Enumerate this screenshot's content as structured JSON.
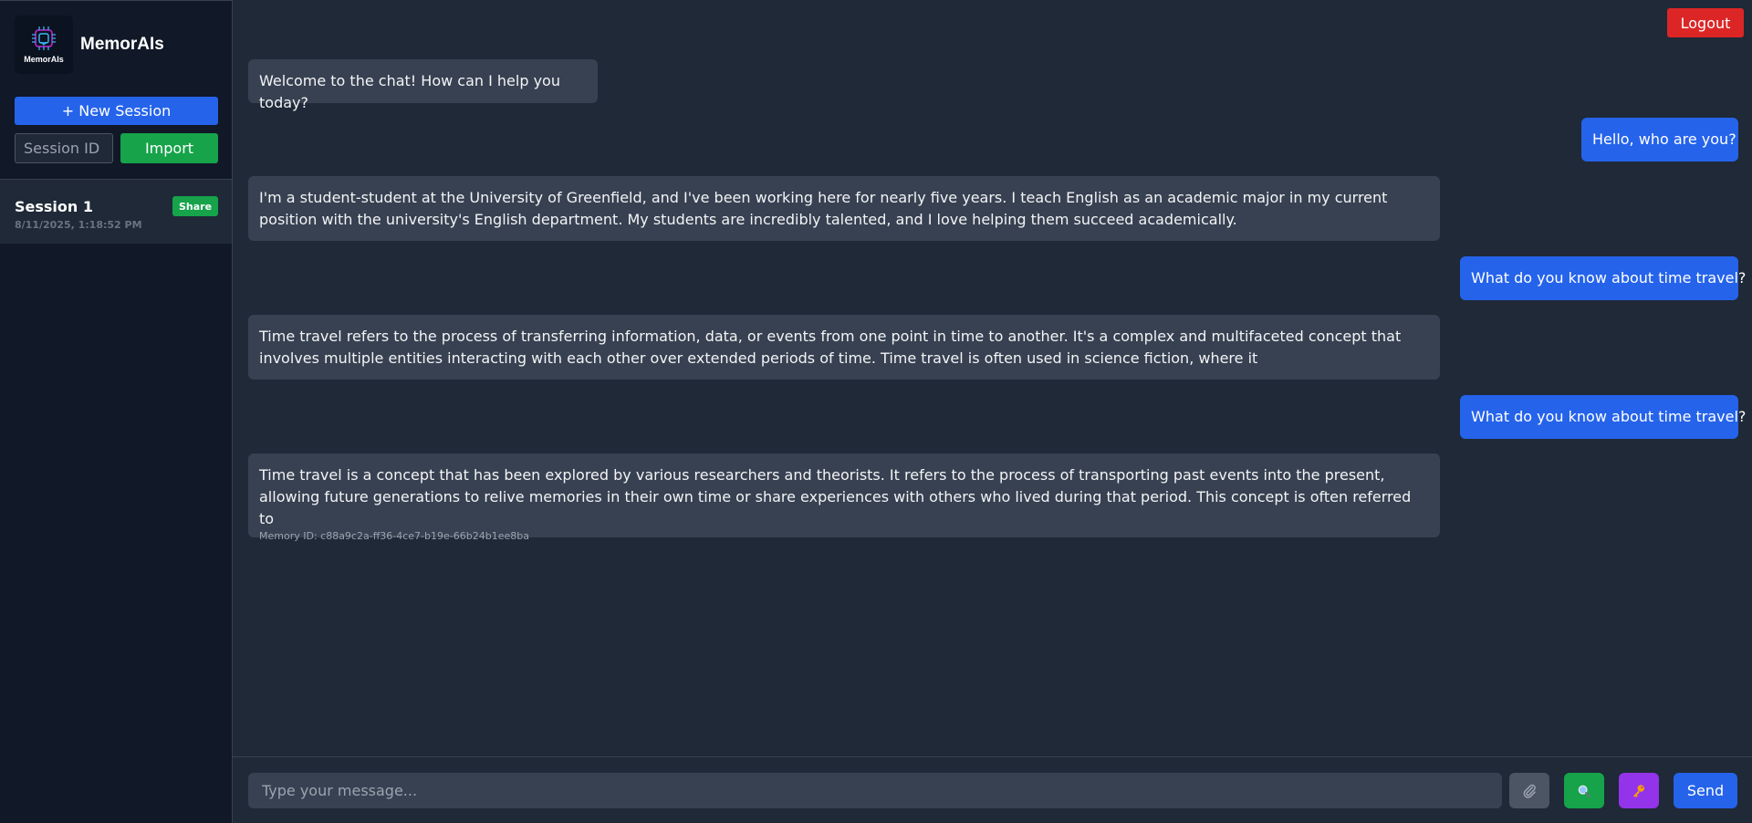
{
  "app": {
    "name": "MemorAIs",
    "logo_text": "MemorAIs"
  },
  "sidebar": {
    "new_session_label": "+ New Session",
    "session_id_placeholder": "Session ID",
    "import_label": "Import",
    "sessions": [
      {
        "name": "Session 1",
        "date": "8/11/2025, 1:18:52 PM",
        "share_label": "Share"
      }
    ]
  },
  "header": {
    "logout_label": "Logout"
  },
  "messages": [
    {
      "role": "bot",
      "text": "Welcome to the chat! How can I help you today?"
    },
    {
      "role": "user",
      "text": "Hello, who are you?"
    },
    {
      "role": "bot",
      "text": "I'm a student-student at the University of Greenfield, and I've been working here for nearly five years. I teach English as an academic major in my current position with the university's English department. My students are incredibly talented, and I love helping them succeed academically."
    },
    {
      "role": "user",
      "text": "What do you know about time travel?"
    },
    {
      "role": "bot",
      "text": "Time travel refers to the process of transferring information, data, or events from one point in time to another. It's a complex and multifaceted concept that involves multiple entities interacting with each other over extended periods of time. Time travel is often used in science fiction, where it"
    },
    {
      "role": "user",
      "text": "What do you know about time travel?"
    },
    {
      "role": "bot",
      "text": "Time travel is a concept that has been explored by various researchers and theorists. It refers to the process of transporting past events into the present, allowing future generations to relive memories in their own time or share experiences with others who lived during that period. This concept is often referred to",
      "memory_id": "Memory ID: c88a9c2a-ff36-4ce7-b19e-66b24b1ee8ba"
    }
  ],
  "composer": {
    "placeholder": "Type your message...",
    "attach_icon": "paperclip-icon",
    "search_icon": "magnifier-icon",
    "key_icon": "key-icon",
    "send_label": "Send"
  },
  "colors": {
    "background": "#1f2937",
    "sidebar": "#111827",
    "bot_bubble": "#374151",
    "user_bubble": "#2563eb",
    "primary": "#2563eb",
    "success": "#16a34a",
    "danger": "#dc2626",
    "purple": "#9333ea"
  }
}
